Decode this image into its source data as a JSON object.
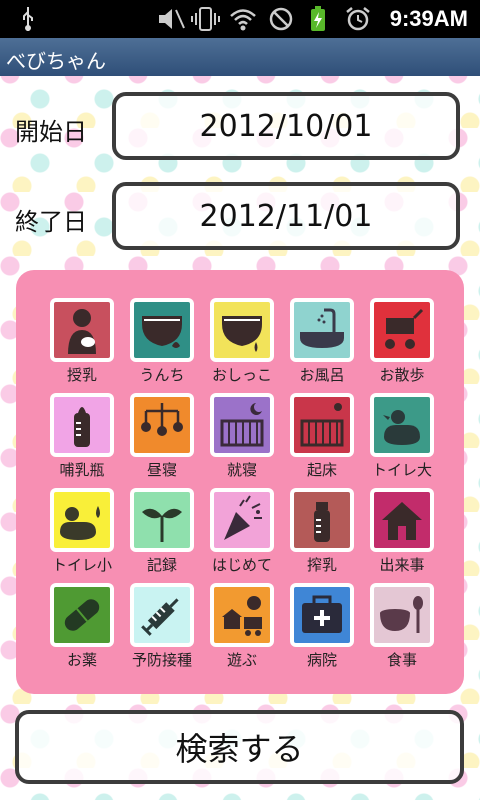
{
  "status_bar": {
    "time": "9:39AM",
    "icons": [
      "usb-icon",
      "mute-icon",
      "vibrate-icon",
      "wifi-icon",
      "block-icon",
      "battery-charging-icon",
      "alarm-icon"
    ]
  },
  "app": {
    "title": "べびちゃん"
  },
  "start": {
    "label": "開始日",
    "value": "2012/10/01"
  },
  "end": {
    "label": "終了日",
    "value": "2012/11/01"
  },
  "grid": {
    "items": [
      {
        "label": "授乳",
        "color": "#c8505e",
        "icon": "nursing-icon"
      },
      {
        "label": "うんち",
        "color": "#2f8f86",
        "icon": "diaper-poop-icon"
      },
      {
        "label": "おしっこ",
        "color": "#f2e35a",
        "icon": "diaper-pee-icon"
      },
      {
        "label": "お風呂",
        "color": "#8fd3cf",
        "icon": "bath-icon"
      },
      {
        "label": "お散歩",
        "color": "#e0313c",
        "icon": "stroller-icon"
      },
      {
        "label": "哺乳瓶",
        "color": "#f1a4e6",
        "icon": "baby-bottle-icon"
      },
      {
        "label": "昼寝",
        "color": "#f08a2c",
        "icon": "mobile-icon"
      },
      {
        "label": "就寝",
        "color": "#9b72c9",
        "icon": "crib-moon-icon"
      },
      {
        "label": "起床",
        "color": "#c9364a",
        "icon": "crib-sun-icon"
      },
      {
        "label": "トイレ大",
        "color": "#3c9a88",
        "icon": "potty-duck-icon"
      },
      {
        "label": "トイレ小",
        "color": "#f9ef39",
        "icon": "potty-duck-drop-icon"
      },
      {
        "label": "記録",
        "color": "#8fe0ad",
        "icon": "sprout-icon"
      },
      {
        "label": "はじめて",
        "color": "#f2a3d8",
        "icon": "party-popper-icon"
      },
      {
        "label": "搾乳",
        "color": "#b45a58",
        "icon": "breast-pump-bottle-icon"
      },
      {
        "label": "出来事",
        "color": "#c22c6b",
        "icon": "house-icon"
      },
      {
        "label": "お薬",
        "color": "#4f9a33",
        "icon": "pill-icon"
      },
      {
        "label": "予防接種",
        "color": "#c9f3f2",
        "icon": "syringe-icon"
      },
      {
        "label": "遊ぶ",
        "color": "#f29a30",
        "icon": "toys-icon"
      },
      {
        "label": "病院",
        "color": "#3f86d6",
        "icon": "hospital-bag-icon"
      },
      {
        "label": "食事",
        "color": "#e4c7d4",
        "icon": "bowl-spoon-icon"
      }
    ]
  },
  "search_button": {
    "label": "検索する"
  }
}
